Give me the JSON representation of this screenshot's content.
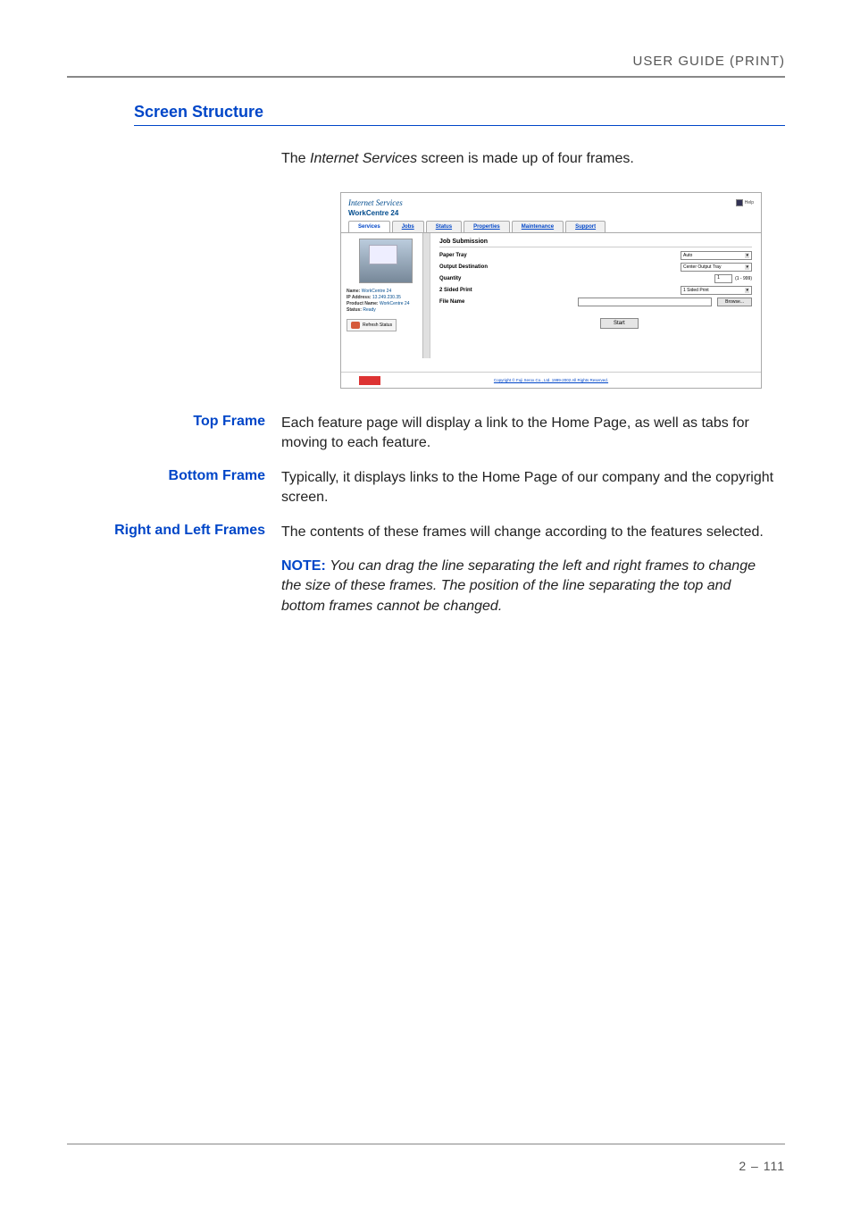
{
  "header": {
    "title": "USER GUIDE (PRINT)"
  },
  "section": {
    "heading": "Screen Structure"
  },
  "intro": {
    "prefix": "The ",
    "italic": "Internet Services",
    "suffix": " screen is made up of four frames."
  },
  "screenshot": {
    "logo_text": "Internet Services",
    "product_name": "WorkCentre 24",
    "help_label": "Help",
    "tabs": [
      "Services",
      "Jobs",
      "Status",
      "Properties",
      "Maintenance",
      "Support"
    ],
    "left": {
      "name_label": "Name:",
      "name_value": "WorkCentre 24",
      "ip_label": "IP Address:",
      "ip_value": "13.249.230.35",
      "product_label": "Product Name:",
      "product_value": "WorkCentre 24",
      "status_label": "Status:",
      "status_value": "Ready",
      "refresh_label": "Refresh Status"
    },
    "form": {
      "title": "Job Submission",
      "paper_tray_label": "Paper Tray",
      "paper_tray_value": "Auto",
      "output_dest_label": "Output Destination",
      "output_dest_value": "Center Output Tray",
      "quantity_label": "Quantity",
      "quantity_value": "1",
      "quantity_range": "(1 - 999)",
      "two_sided_label": "2 Sided Print",
      "two_sided_value": "1 Sided Print",
      "file_name_label": "File Name",
      "browse_label": "Browse...",
      "start_label": "Start"
    },
    "copyright": "Copyright © Fuji Xerox Co., Ltd. 1999-2002 All Rights Reserved."
  },
  "definitions": [
    {
      "label": "Top Frame",
      "body": "Each feature page will display a link to the Home Page, as well as tabs for moving to each feature."
    },
    {
      "label": "Bottom Frame",
      "body": "Typically, it displays links to the Home Page of our company and the copyright screen."
    },
    {
      "label": "Right and Left Frames",
      "body": "The contents of these frames will change according to the features selected."
    }
  ],
  "note": {
    "label": "NOTE:",
    "body": "You can drag the line separating the left and right frames to change the size of these frames. The position of the line separating the top and bottom frames cannot be changed."
  },
  "footer": {
    "page_number": "2 – 111"
  }
}
